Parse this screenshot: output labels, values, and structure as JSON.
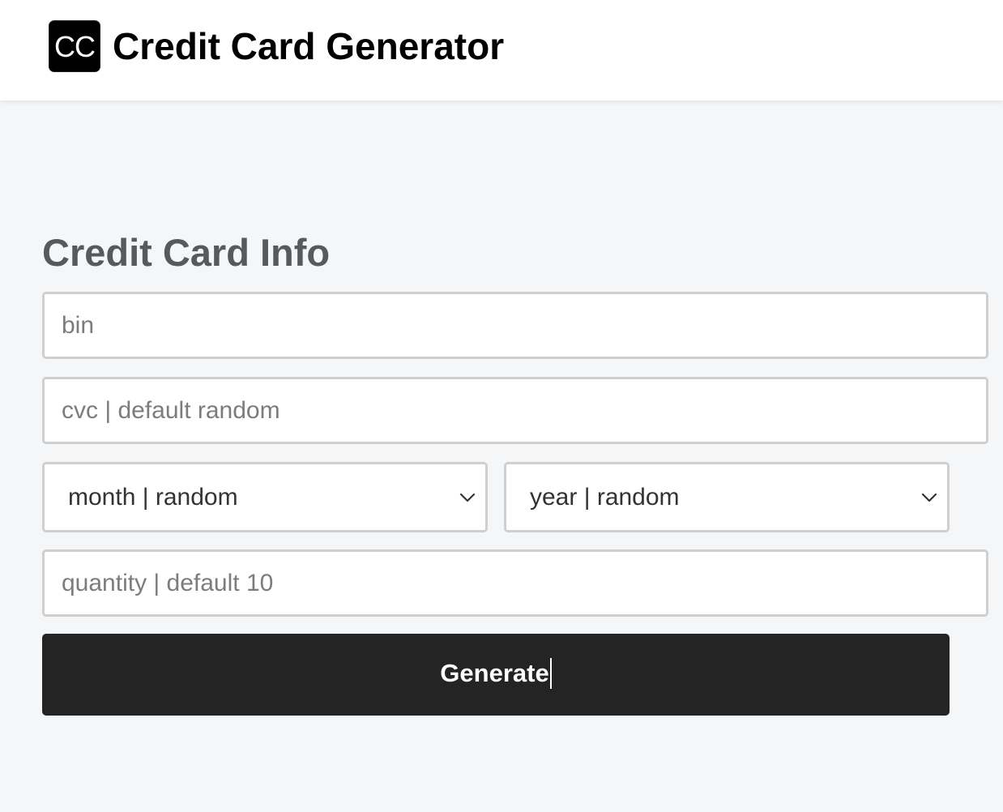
{
  "header": {
    "logo_text": "CC",
    "title": "Credit Card Generator"
  },
  "form": {
    "title": "Credit Card Info",
    "bin": {
      "placeholder": "bin",
      "value": ""
    },
    "cvc": {
      "placeholder": "cvc | default random",
      "value": ""
    },
    "month": {
      "selected": "month | random"
    },
    "year": {
      "selected": "year | random"
    },
    "quantity": {
      "placeholder": "quantity | default 10",
      "value": ""
    },
    "generate_label": "Generate"
  },
  "colors": {
    "page_background": "#f5f6f8",
    "header_background": "#ffffff",
    "button_background": "#242424",
    "title_color": "#58595b",
    "field_border": "#cfcfcf"
  }
}
